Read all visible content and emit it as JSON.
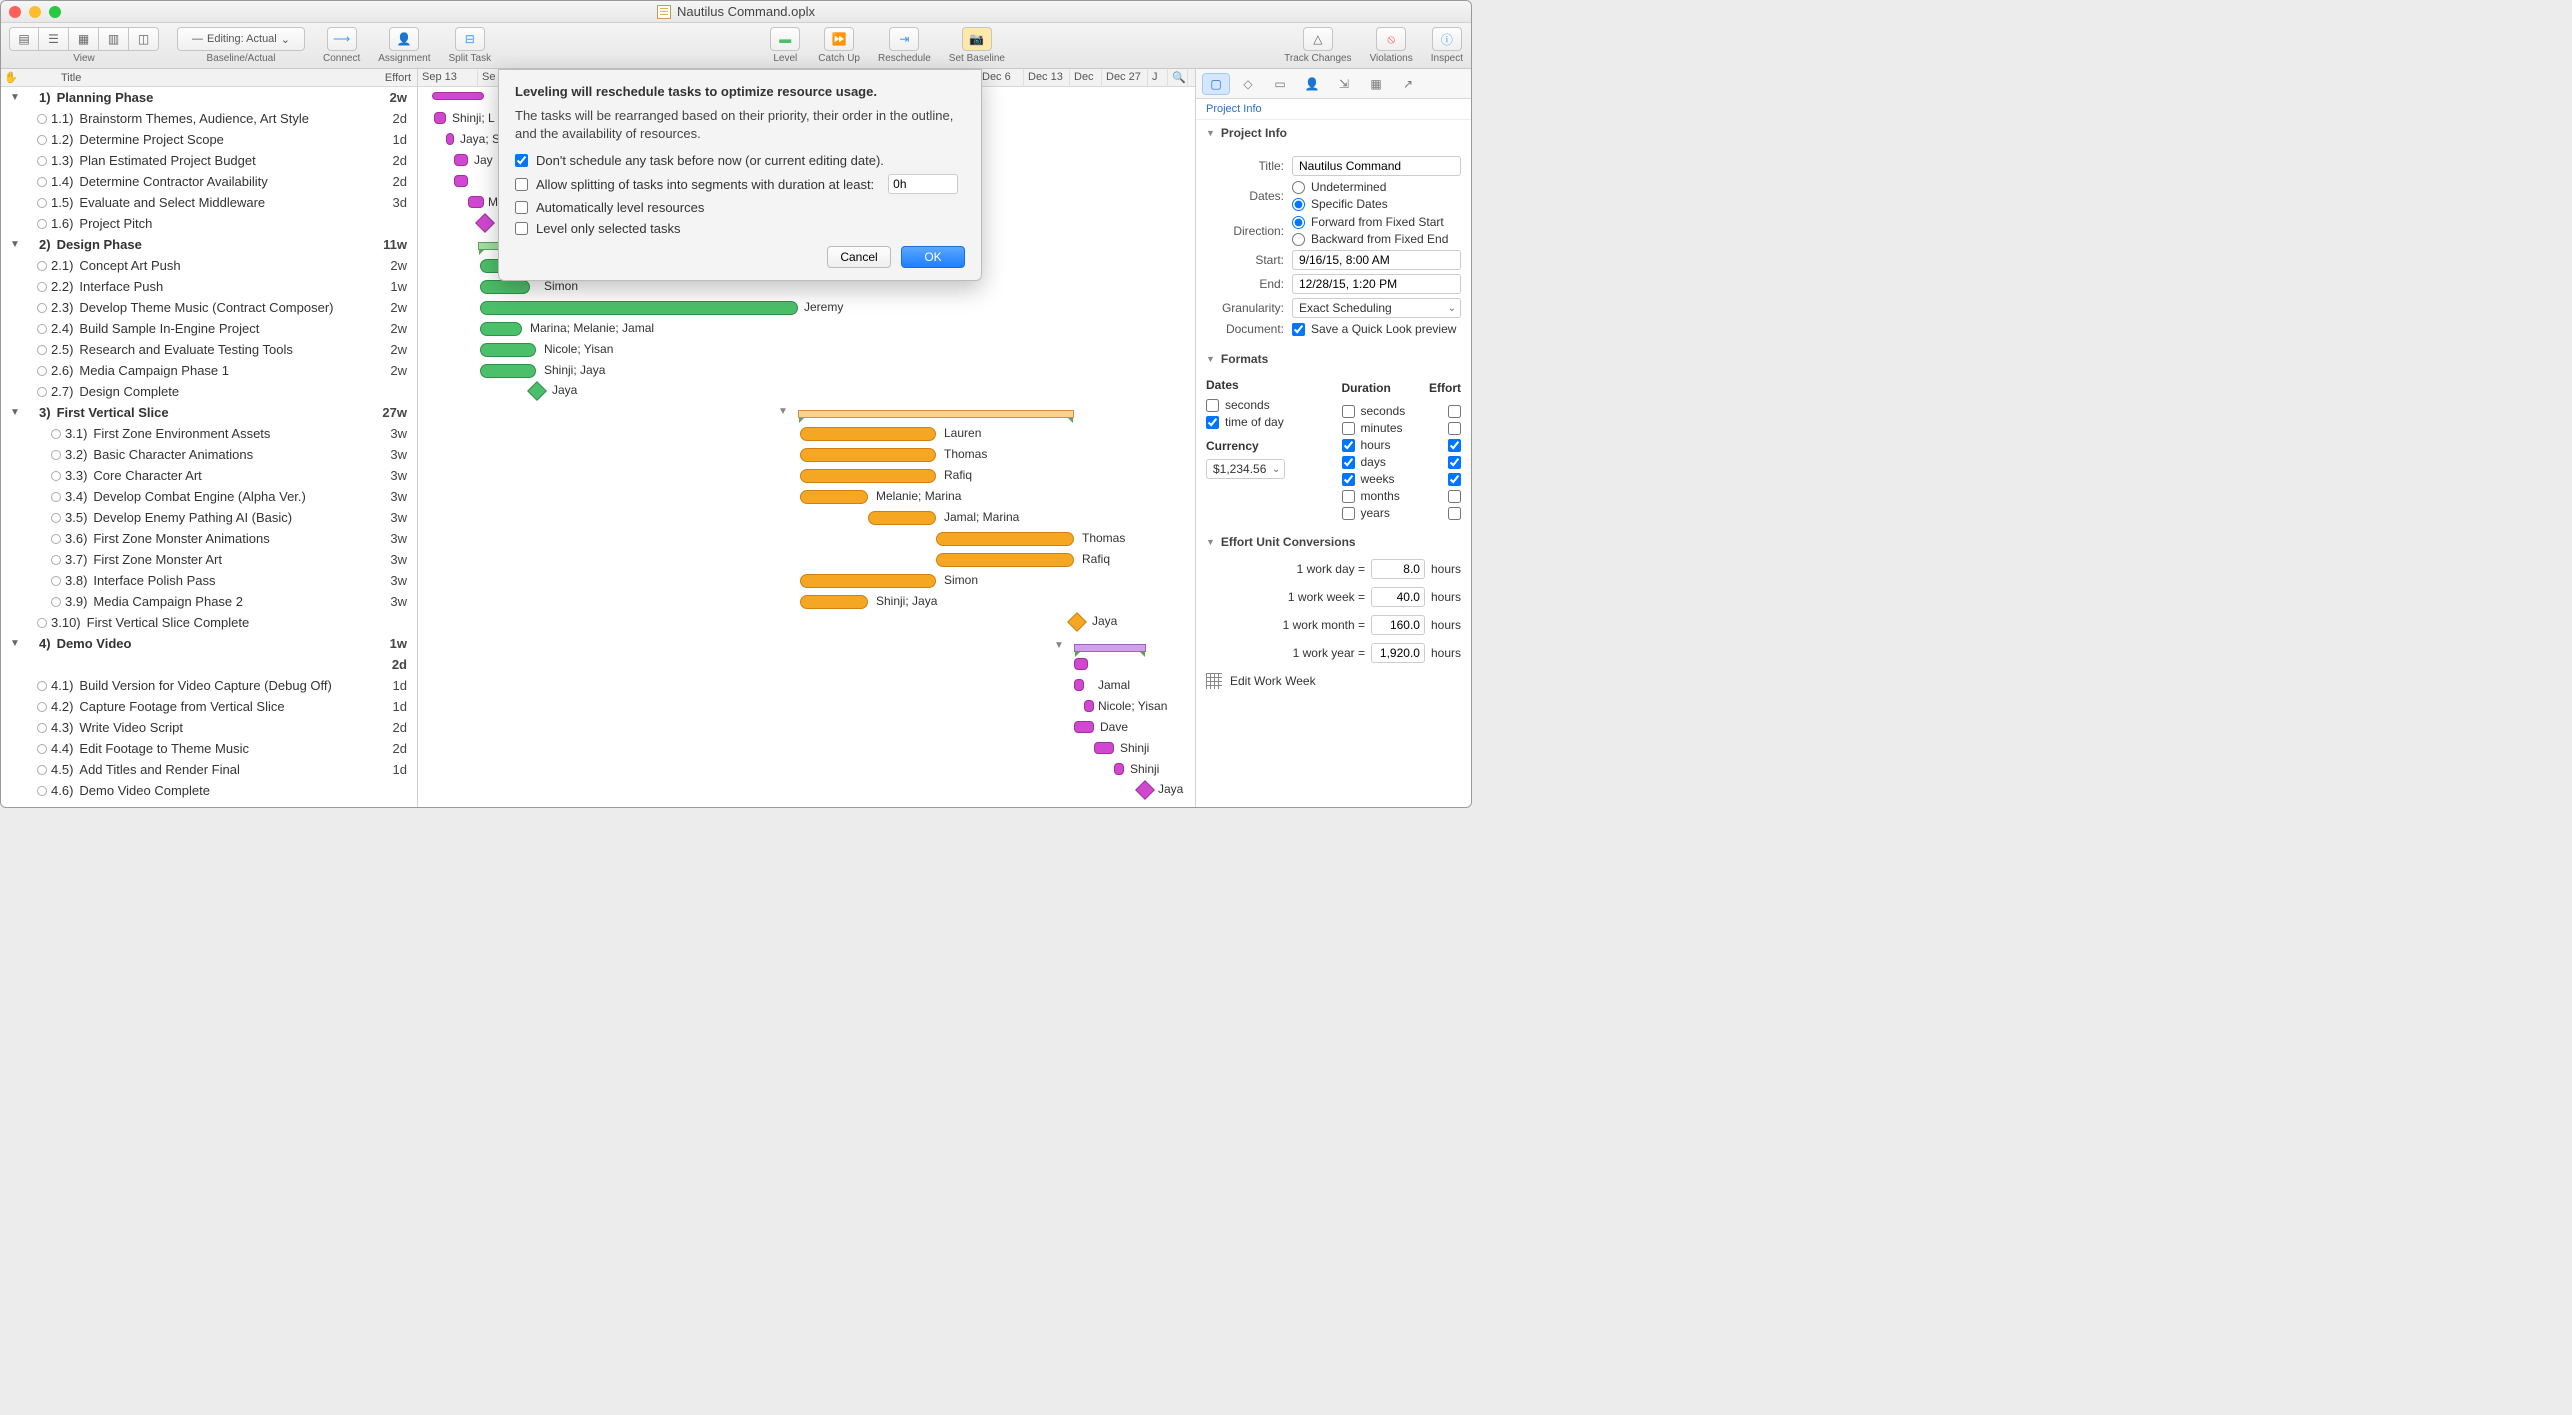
{
  "window": {
    "title": "Nautilus Command.oplx"
  },
  "toolbar": {
    "view": "View",
    "baseline_actual": "Baseline/Actual",
    "editing_actual": "Editing: Actual",
    "connect": "Connect",
    "assignment": "Assignment",
    "split_task": "Split Task",
    "level": "Level",
    "catch_up": "Catch Up",
    "reschedule": "Reschedule",
    "set_baseline": "Set Baseline",
    "track_changes": "Track Changes",
    "violations": "Violations",
    "inspect": "Inspect"
  },
  "outline_header": {
    "title": "Title",
    "effort": "Effort"
  },
  "gantt_header": [
    "Sep 13",
    "Se",
    "Dec 6",
    "Dec 13",
    "Dec",
    "Dec 27",
    "J"
  ],
  "tasks": [
    {
      "lvl": 0,
      "disc": true,
      "num": "1)",
      "title": "Planning Phase",
      "effort": "2w"
    },
    {
      "lvl": 1,
      "num": "1.1)",
      "title": "Brainstorm Themes, Audience, Art Style",
      "effort": "2d"
    },
    {
      "lvl": 1,
      "num": "1.2)",
      "title": "Determine Project Scope",
      "effort": "1d"
    },
    {
      "lvl": 1,
      "num": "1.3)",
      "title": "Plan Estimated Project Budget",
      "effort": "2d"
    },
    {
      "lvl": 1,
      "num": "1.4)",
      "title": "Determine Contractor Availability",
      "effort": "2d"
    },
    {
      "lvl": 1,
      "num": "1.5)",
      "title": "Evaluate and Select Middleware",
      "effort": "3d"
    },
    {
      "lvl": 1,
      "num": "1.6)",
      "title": "Project Pitch",
      "effort": ""
    },
    {
      "lvl": 0,
      "disc": true,
      "num": "2)",
      "title": "Design Phase",
      "effort": "11w"
    },
    {
      "lvl": 1,
      "num": "2.1)",
      "title": "Concept Art Push",
      "effort": "2w"
    },
    {
      "lvl": 1,
      "num": "2.2)",
      "title": "Interface Push",
      "effort": "1w"
    },
    {
      "lvl": 1,
      "num": "2.3)",
      "title": "Develop Theme Music (Contract Composer)",
      "effort": "2w"
    },
    {
      "lvl": 1,
      "num": "2.4)",
      "title": "Build Sample In-Engine Project",
      "effort": "2w"
    },
    {
      "lvl": 1,
      "num": "2.5)",
      "title": "Research and Evaluate Testing Tools",
      "effort": "2w"
    },
    {
      "lvl": 1,
      "num": "2.6)",
      "title": "Media Campaign Phase 1",
      "effort": "2w"
    },
    {
      "lvl": 1,
      "num": "2.7)",
      "title": "Design Complete",
      "effort": ""
    },
    {
      "lvl": 0,
      "disc": true,
      "num": "3)",
      "title": "First Vertical Slice",
      "effort": "27w"
    },
    {
      "lvl": 2,
      "num": "3.1)",
      "title": "First Zone Environment Assets",
      "effort": "3w"
    },
    {
      "lvl": 2,
      "num": "3.2)",
      "title": "Basic Character Animations",
      "effort": "3w"
    },
    {
      "lvl": 2,
      "num": "3.3)",
      "title": "Core Character Art",
      "effort": "3w"
    },
    {
      "lvl": 2,
      "num": "3.4)",
      "title": "Develop Combat Engine (Alpha Ver.)",
      "effort": "3w"
    },
    {
      "lvl": 2,
      "num": "3.5)",
      "title": "Develop Enemy Pathing AI (Basic)",
      "effort": "3w"
    },
    {
      "lvl": 2,
      "num": "3.6)",
      "title": "First Zone Monster Animations",
      "effort": "3w"
    },
    {
      "lvl": 2,
      "num": "3.7)",
      "title": "First Zone Monster Art",
      "effort": "3w"
    },
    {
      "lvl": 2,
      "num": "3.8)",
      "title": "Interface Polish Pass",
      "effort": "3w"
    },
    {
      "lvl": 2,
      "num": "3.9)",
      "title": "Media Campaign Phase 2",
      "effort": "3w"
    },
    {
      "lvl": 1,
      "num": "3.10)",
      "title": "First Vertical Slice Complete",
      "effort": ""
    },
    {
      "lvl": 0,
      "disc": true,
      "num": "4)",
      "title": "Demo Video",
      "effort": "1w"
    },
    {
      "lvl": 0,
      "num": "",
      "title": "",
      "effort": "2d"
    },
    {
      "lvl": 1,
      "num": "4.1)",
      "title": "Build Version for Video Capture (Debug Off)",
      "effort": "1d"
    },
    {
      "lvl": 1,
      "num": "4.2)",
      "title": "Capture Footage from Vertical Slice",
      "effort": "1d"
    },
    {
      "lvl": 1,
      "num": "4.3)",
      "title": "Write Video Script",
      "effort": "2d"
    },
    {
      "lvl": 1,
      "num": "4.4)",
      "title": "Edit Footage to Theme Music",
      "effort": "2d"
    },
    {
      "lvl": 1,
      "num": "4.5)",
      "title": "Add Titles and Render Final",
      "effort": "1d"
    },
    {
      "lvl": 1,
      "num": "4.6)",
      "title": "Demo Video Complete",
      "effort": ""
    }
  ],
  "gantt_labels": {
    "r1": "Shinji; L",
    "r2": "Jaya; S",
    "r3": "Jay",
    "r4": "M",
    "r8_sum": "",
    "r9": "",
    "r10": "Simon",
    "r11": "Jeremy",
    "r12": "Marina; Melanie; Jamal",
    "r13": "Nicole; Yisan",
    "r14": "Shinji; Jaya",
    "r15": "Jaya",
    "r17": "Lauren",
    "r18": "Thomas",
    "r19": "Rafiq",
    "r20": "Melanie; Marina",
    "r21": "Jamal; Marina",
    "r22": "Thomas",
    "r23": "Rafiq",
    "r24": "Simon",
    "r25": "Shinji; Jaya",
    "r26": "Jaya",
    "r29": "Jamal",
    "r30": "Nicole; Yisan",
    "r31": "Dave",
    "r32": "Shinji",
    "r33": "Shinji",
    "r34": "Jaya"
  },
  "dialog": {
    "title": "Leveling will reschedule tasks to optimize resource usage.",
    "body": "The tasks will be rearranged based on their priority, their order in the outline, and the availability of resources.",
    "opt1": "Don't schedule any task before now (or current editing date).",
    "opt2": "Allow splitting of tasks into segments with duration at least:",
    "opt2_val": "0h",
    "opt3": "Automatically level resources",
    "opt4": "Level only selected tasks",
    "cancel": "Cancel",
    "ok": "OK"
  },
  "inspector": {
    "crumb": "Project Info",
    "section_info": "Project Info",
    "title_label": "Title:",
    "title_val": "Nautilus Command",
    "dates_label": "Dates:",
    "dates_undet": "Undetermined",
    "dates_spec": "Specific Dates",
    "dir_label": "Direction:",
    "dir_fwd": "Forward from Fixed Start",
    "dir_bwd": "Backward from Fixed End",
    "start_label": "Start:",
    "start_val": "9/16/15, 8:00 AM",
    "end_label": "End:",
    "end_val": "12/28/15, 1:20 PM",
    "gran_label": "Granularity:",
    "gran_val": "Exact Scheduling",
    "doc_label": "Document:",
    "doc_opt": "Save a Quick Look preview",
    "section_formats": "Formats",
    "fmt_dates": "Dates",
    "fmt_dur": "Duration",
    "fmt_eff": "Effort",
    "seconds": "seconds",
    "tod": "time of day",
    "minutes": "minutes",
    "hours": "hours",
    "days": "days",
    "weeks": "weeks",
    "months": "months",
    "years": "years",
    "currency": "Currency",
    "currency_val": "$1,234.56",
    "section_conv": "Effort Unit Conversions",
    "c_day": "1 work day =",
    "c_day_v": "8.0",
    "c_hours": "hours",
    "c_week": "1 work week =",
    "c_week_v": "40.0",
    "c_month": "1 work month =",
    "c_month_v": "160.0",
    "c_year": "1 work year =",
    "c_year_v": "1,920.0",
    "edit_ww": "Edit Work Week"
  }
}
